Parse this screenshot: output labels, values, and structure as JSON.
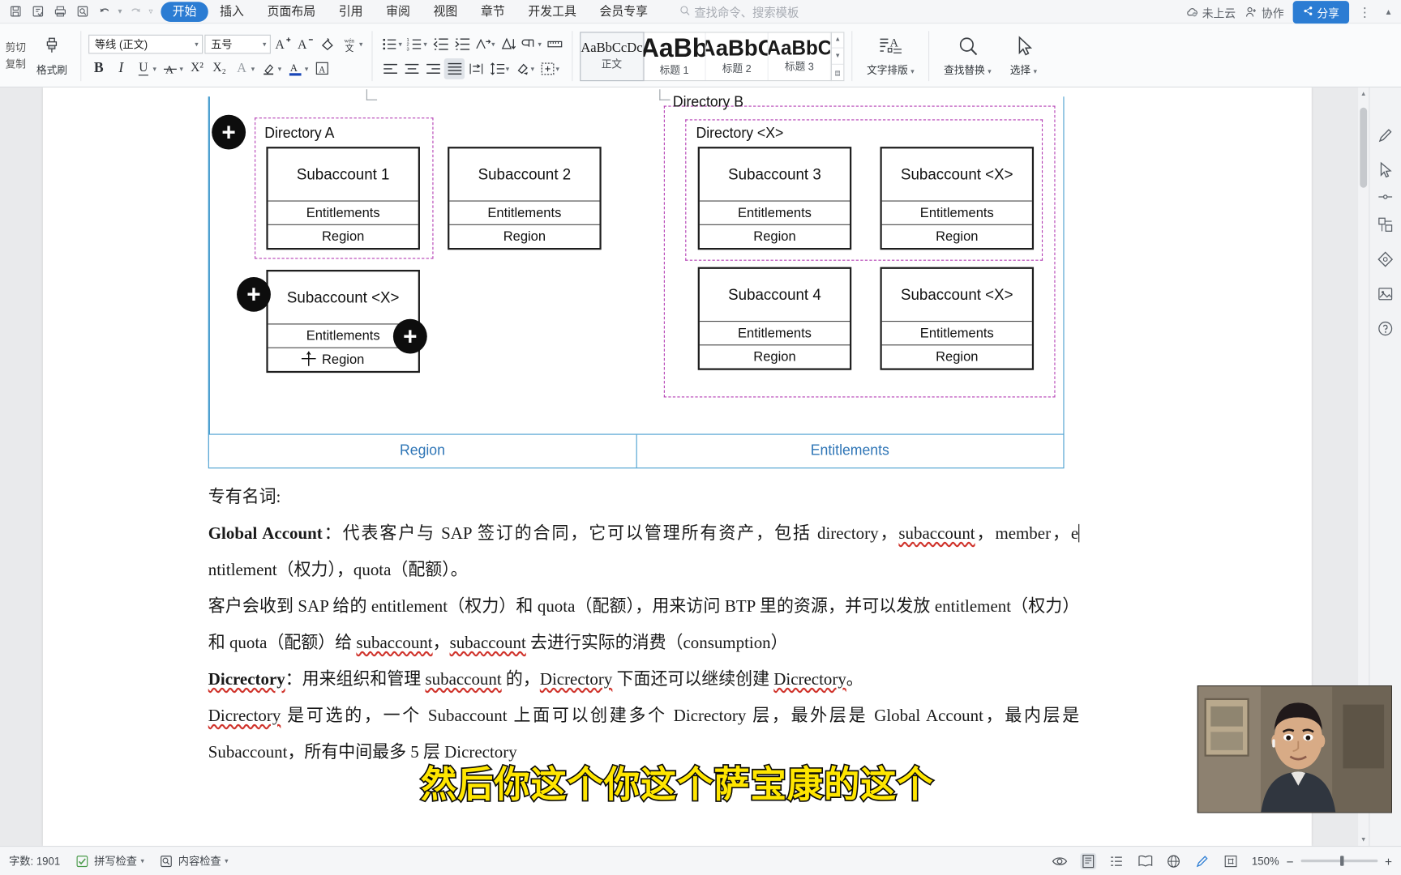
{
  "app": {
    "quick_access": [
      {
        "name": "save-icon",
        "label": "保存"
      },
      {
        "name": "save-as-icon",
        "label": "另存为"
      },
      {
        "name": "print-icon",
        "label": "打印"
      },
      {
        "name": "print-preview-icon",
        "label": "打印预览"
      },
      {
        "name": "undo-icon",
        "label": "撤销"
      },
      {
        "name": "redo-icon",
        "label": "恢复"
      },
      {
        "name": "customize-qat-icon",
        "label": "自定义快速访问工具栏"
      }
    ],
    "tabs": [
      {
        "label": "开始",
        "active": true
      },
      {
        "label": "插入",
        "active": false
      },
      {
        "label": "页面布局",
        "active": false
      },
      {
        "label": "引用",
        "active": false
      },
      {
        "label": "审阅",
        "active": false
      },
      {
        "label": "视图",
        "active": false
      },
      {
        "label": "章节",
        "active": false
      },
      {
        "label": "开发工具",
        "active": false
      },
      {
        "label": "会员专享",
        "active": false
      }
    ],
    "search_placeholder": "查找命令、搜索模板",
    "cloud_status": "未上云",
    "collaborate": "协作",
    "share": "分享"
  },
  "ribbon": {
    "clipboard": {
      "cut": "剪切",
      "copy": "复制",
      "format_painter": "格式刷"
    },
    "font": {
      "family": "等线 (正文)",
      "size": "五号",
      "grow_label": "增大字号",
      "shrink_label": "减小字号",
      "clear_format_label": "清除格式",
      "pinyin_label": "拼音指南",
      "bold": "B",
      "italic": "I",
      "underline": "U",
      "strikethrough": "A",
      "superscript": "X²",
      "subscript": "X₂",
      "text_effect": "A",
      "highlight": "A",
      "font_color": "A",
      "char_border": "A"
    },
    "paragraph": {
      "bullets_label": "项目符号",
      "numbering_label": "编号",
      "decrease_indent_label": "减少缩进量",
      "increase_indent_label": "增加缩进量",
      "multilevel_label": "多级编号",
      "sort_label": "排序",
      "show_marks_label": "显示/隐藏编辑标记",
      "align_left_label": "左对齐",
      "align_center_label": "居中对齐",
      "align_right_label": "右对齐",
      "align_justify_label": "两端对齐",
      "distribute_label": "分散对齐",
      "line_spacing_label": "行距",
      "shading_label": "底纹",
      "borders_label": "边框"
    },
    "styles": [
      {
        "preview": "AaBbCcDc",
        "label": "正文",
        "selected": true,
        "size": "15px"
      },
      {
        "preview": "AaBb",
        "label": "标题 1",
        "selected": false,
        "size": "30px"
      },
      {
        "preview": "AaBbC",
        "label": "标题 2",
        "selected": false,
        "size": "26px"
      },
      {
        "preview": "AaBbC",
        "label": "标题 3",
        "selected": false,
        "size": "22px"
      }
    ],
    "text_layout": "文字排版",
    "find_replace": "查找替换",
    "select": "选择"
  },
  "diagram": {
    "directory_a_label": "Directory A",
    "directory_b_label": "Directory B",
    "directory_x_label": "Directory <X>",
    "subaccount_x_left_label": "Subaccount <X>",
    "cards": [
      {
        "title": "Subaccount 1",
        "rows": [
          "Entitlements",
          "Region"
        ]
      },
      {
        "title": "Subaccount 2",
        "rows": [
          "Entitlements",
          "Region"
        ]
      },
      {
        "title": "Subaccount 3",
        "rows": [
          "Entitlements",
          "Region"
        ]
      },
      {
        "title": "Subaccount <X>",
        "rows": [
          "Entitlements",
          "Region"
        ]
      },
      {
        "title": "Subaccount 4",
        "rows": [
          "Entitlements",
          "Region"
        ]
      },
      {
        "title": "Subaccount <X>",
        "rows": [
          "Entitlements",
          "Region"
        ]
      }
    ],
    "subaccount_x_rows": [
      "Entitlements",
      "Region"
    ],
    "footer": {
      "left": "Region",
      "right": "Entitlements"
    },
    "plus_badges": [
      "+",
      "+",
      "+"
    ],
    "colors": {
      "dashed_border": "#b43fb4",
      "card_border": "#1d1d1d",
      "footer_border": "#4a9fd0",
      "footer_text": "#2e75b6"
    }
  },
  "document": {
    "paragraphs": [
      {
        "id": "p1",
        "html": "专有名词:"
      },
      {
        "id": "p2",
        "html": "<b>Global Account</b>：代表客户与 SAP 签订的合同，它可以管理所有资产，包括 directory，<span class=\"sq\">subaccount</span>，member，e<span class=\"caret\"></span>ntitlement（权力），quota（配额）。"
      },
      {
        "id": "p3",
        "html": "客户会收到 SAP 给的 entitlement（权力）和 quota（配额），用来访问 BTP 里的资源，并可以发放 entitlement（权力）和 quota（配额）给 <span class=\"sq\">subaccount</span>，<span class=\"sq\">subaccount</span> 去进行实际的消费（consumption）"
      },
      {
        "id": "p4",
        "html": "<b class=\"sq\">Dicrectory</b>：用来组织和管理 <span class=\"sq\">subaccount</span> 的，<span class=\"sq\">Dicrectory</span> 下面还可以继续创建 <span class=\"sq\">Dicrectory</span>。"
      },
      {
        "id": "p5",
        "html": "<span class=\"sq\">Dicrectory</span> 是可选的，一个 Subaccount 上面可以创建多个 Dicrectory 层，最外层是 Global Account，最内层是 Subaccount，所有中间最多 5 层 Dicrectory"
      }
    ]
  },
  "subtitle": {
    "text": "然后你这个你这个萨宝康的这个",
    "fill_color": "#ffe600",
    "stroke_color": "#0a0a0a"
  },
  "status_bar": {
    "word_count": "字数: 1901",
    "spell_check": "拼写检查",
    "content_check": "内容检查",
    "view_eye_label": "护眼模式",
    "view_modes": [
      {
        "name": "page-view-icon",
        "label": "页面视图"
      },
      {
        "name": "outline-view-icon",
        "label": "大纲视图"
      },
      {
        "name": "reading-view-icon",
        "label": "阅读版式"
      },
      {
        "name": "web-view-icon",
        "label": "Web版式"
      },
      {
        "name": "annotate-icon",
        "label": "书写工具"
      }
    ],
    "zoom": "150%",
    "zoom_out": "−",
    "zoom_in": "+",
    "fit_label": "适合窗口"
  },
  "right_sidebar": {
    "items": [
      {
        "name": "pen-tool-icon",
        "label": "编辑"
      },
      {
        "name": "cursor-select-icon",
        "label": "选择"
      },
      {
        "name": "divider",
        "label": ""
      },
      {
        "name": "shapes-icon",
        "label": "形状"
      },
      {
        "name": "diamond-icon",
        "label": "特色功能"
      },
      {
        "name": "image-tools-icon",
        "label": "图片工具"
      },
      {
        "name": "help-icon",
        "label": "帮助"
      }
    ]
  }
}
